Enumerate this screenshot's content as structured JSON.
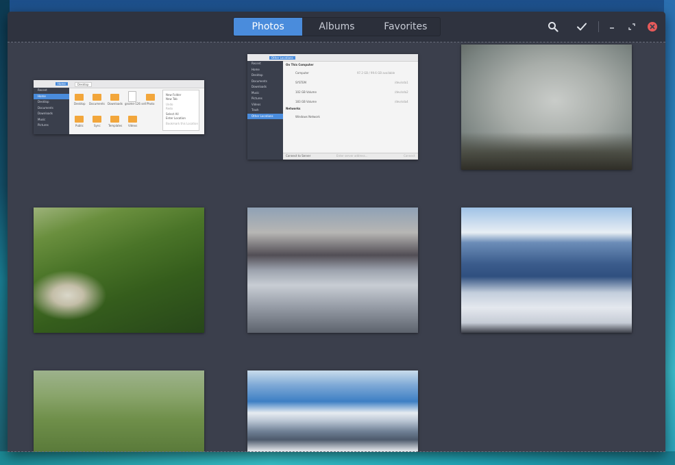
{
  "header": {
    "tabs": [
      {
        "label": "Photos",
        "active": true
      },
      {
        "label": "Albums",
        "active": false
      },
      {
        "label": "Favorites",
        "active": false
      }
    ],
    "icons": [
      "search-icon",
      "check-icon",
      "minimize-icon",
      "restore-icon",
      "close-icon"
    ]
  },
  "colors": {
    "accent": "#4a8cdc",
    "headerbar": "#2f333f",
    "content_bg": "#3b3f4c",
    "close": "#e65a5a"
  },
  "thumb_files": {
    "sidebar": [
      "Recent",
      "Home",
      "Desktop",
      "Documents",
      "Downloads",
      "Music",
      "Pictures"
    ],
    "path": [
      "Home",
      "Desktop"
    ],
    "folders": [
      "Desktop",
      "Documents",
      "Downloads",
      "gnome-126 sell",
      "Photo",
      "Public",
      "Sync",
      "Templates",
      "Videos"
    ],
    "menu": [
      "New Folder",
      "New Tab",
      "Undo",
      "Redo",
      "Select All",
      "Enter Location",
      "Bookmark this Location"
    ]
  },
  "thumb_locations": {
    "sidebar": [
      "Recent",
      "Home",
      "Desktop",
      "Documents",
      "Downloads",
      "Music",
      "Pictures",
      "Videos",
      "Trash",
      "Other Locations"
    ],
    "path": "Other Locations",
    "section": "On This Computer",
    "rows": [
      {
        "name": "Computer",
        "info": "97.2 GB / 99.6 GB available"
      },
      {
        "name": "SYSTEM",
        "info": "/dev/sda1"
      },
      {
        "name": "102 GB Volume",
        "info": "/dev/sda2"
      },
      {
        "name": "183 GB Volume",
        "info": "/dev/sda4"
      }
    ],
    "networks": "Networks",
    "network_row": "Windows Network",
    "footer": "Connect to Server",
    "footer_placeholder": "Enter server address...",
    "footer_button": "Connect"
  }
}
